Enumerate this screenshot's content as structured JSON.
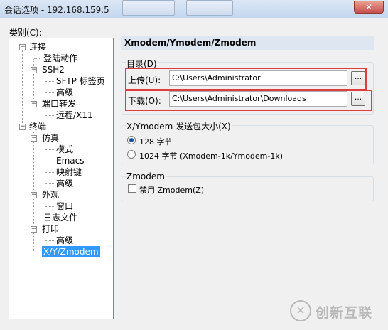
{
  "window": {
    "title": "会话选项 - 192.168.159.5",
    "close_glyph": "✕"
  },
  "category_label": "类别(C):",
  "tree": [
    {
      "label": "连接"
    },
    {
      "label": "登陆动作"
    },
    {
      "label": "SSH2"
    },
    {
      "label": "SFTP 标签页"
    },
    {
      "label": "高级"
    },
    {
      "label": "端口转发"
    },
    {
      "label": "远程/X11"
    },
    {
      "label": "终端"
    },
    {
      "label": "仿真"
    },
    {
      "label": "模式"
    },
    {
      "label": "Emacs"
    },
    {
      "label": "映射键"
    },
    {
      "label": "高级"
    },
    {
      "label": "外观"
    },
    {
      "label": "窗口"
    },
    {
      "label": "日志文件"
    },
    {
      "label": "打印"
    },
    {
      "label": "高级"
    },
    {
      "label": "X/Y/Zmodem"
    }
  ],
  "expand_collapse": "−",
  "panel": {
    "header": "Xmodem/Ymodem/Zmodem",
    "dir_group": "目录(D)",
    "upload_label": "上传(U):",
    "upload_value": "C:\\Users\\Administrator",
    "download_label": "下载(O):",
    "download_value": "C:\\Users\\Administrator\\Downloads",
    "browse_label": "...",
    "packet_group": "X/Ymodem 发送包大小(X)",
    "opt_128": "128 字节",
    "opt_1024": "1024 字节  (Xmodem-1k/Ymodem-1k)",
    "zmodem_group": "Zmodem",
    "disable_zmodem": "禁用 Zmodem(Z)"
  },
  "watermark": {
    "mark": "✕",
    "text": "创新互联"
  }
}
